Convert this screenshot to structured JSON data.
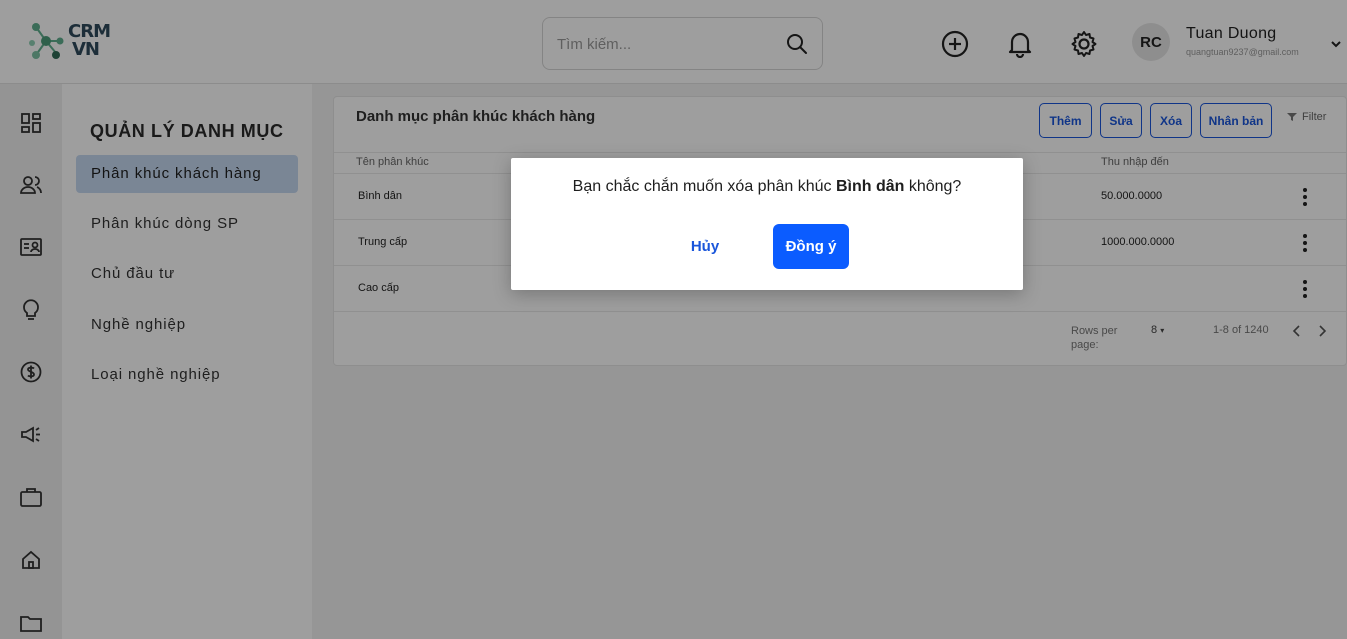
{
  "brand": {
    "logo_line1": "CRM",
    "logo_line2": "VN",
    "colors": {
      "primary": "#1a56db",
      "confirm": "#0b5cff",
      "active_item": "#c6d9f1"
    }
  },
  "search": {
    "placeholder": "Tìm kiếm...",
    "icon": "search-icon"
  },
  "header_icons": [
    "add-circle-icon",
    "bell-icon",
    "gear-icon"
  ],
  "user": {
    "initials": "RC",
    "name": "Tuan Duong",
    "email": "quangtuan9237@gmail.com"
  },
  "rail_icons": [
    "dashboard-icon",
    "users-icon",
    "contact-card-icon",
    "lightbulb-icon",
    "dollar-icon",
    "megaphone-icon",
    "briefcase-icon",
    "home-icon",
    "folder-icon"
  ],
  "sidebar": {
    "title": "QUẢN LÝ DANH MỤC",
    "items": [
      {
        "label": "Phân khúc khách hàng",
        "active": true
      },
      {
        "label": "Phân khúc dòng SP",
        "active": false
      },
      {
        "label": "Chủ đầu tư",
        "active": false
      },
      {
        "label": "Nghề nghiệp",
        "active": false
      },
      {
        "label": "Loại nghề nghiệp",
        "active": false
      }
    ]
  },
  "main": {
    "title": "Danh mục phân khúc khách hàng",
    "buttons": {
      "add": "Thêm",
      "edit": "Sửa",
      "delete": "Xóa",
      "duplicate": "Nhân bản",
      "filter": "Filter"
    },
    "columns": [
      "Tên phân khúc",
      "Thu nhập đến"
    ],
    "rows": [
      {
        "name": "Bình dân",
        "income_to": "50.000.0000"
      },
      {
        "name": "Trung cấp",
        "income_to": "1000.000.0000"
      },
      {
        "name": "Cao cấp",
        "income_to": ""
      }
    ],
    "pagination": {
      "rows_per_page_label": "Rows per page:",
      "rows_per_page": "8",
      "range": "1-8 of 1240"
    }
  },
  "dialog": {
    "message_before": "Bạn chắc chắn muốn xóa phân khúc ",
    "message_bold": "Bình dân",
    "message_after": " không?",
    "cancel": "Hủy",
    "confirm": "Đồng ý"
  }
}
